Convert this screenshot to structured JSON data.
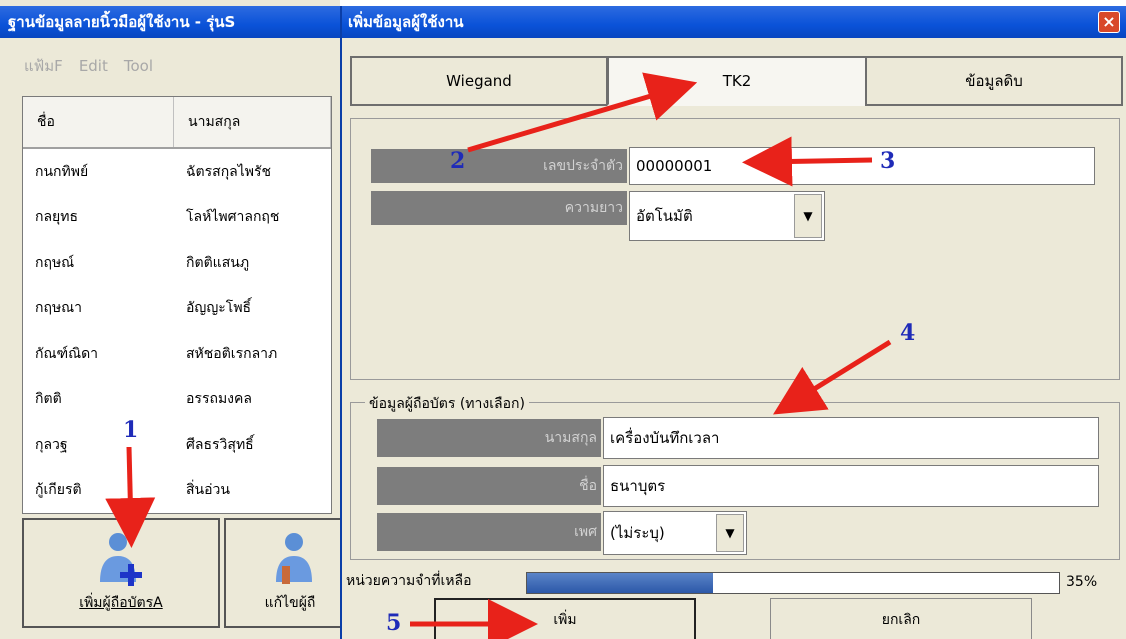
{
  "main_window": {
    "title": "ฐานข้อมูลลายนิ้วมือผู้ใช้งาน - รุ่นS",
    "menu": [
      "แฟ้มF",
      "Edit",
      "Tool"
    ],
    "list": {
      "headers": [
        "ชื่อ",
        "นามสกุล"
      ],
      "rows": [
        [
          "กนกทิพย์",
          "ฉัตรสกุลไพรัช"
        ],
        [
          "กลยุทธ",
          "โลห์ไพศาลกฤช"
        ],
        [
          "กฤษณ์",
          "กิตติแสนภู"
        ],
        [
          "กฤษณา",
          "อัญญะโพธิ์"
        ],
        [
          "กัณฑ์ณิดา",
          "สหัชอติเรกลาภ"
        ],
        [
          "กิตติ",
          "อรรถมงคล"
        ],
        [
          "กุลวฐ",
          "ศีลธรวิสุทธิ์"
        ],
        [
          "กู้เกียรติ",
          "สิ่นอ่วน"
        ]
      ]
    },
    "toolbar": {
      "add_label": "เพิ่มผู้ถือบัตรA",
      "edit_label": "แก้ไขผู้ถื"
    }
  },
  "dialog": {
    "title": "เพิ่มข้อมูลผู้ใช้งาน",
    "close_label": "×",
    "tabs": [
      "Wiegand",
      "TK2",
      "ข้อมูลดิบ"
    ],
    "id_label": "เลขประจำตัว",
    "id_value": "00000001",
    "length_label": "ความยาว",
    "length_value": "อัตโนมัติ",
    "optional_group_label": "ข้อมูลผู้ถือบัตร (ทางเลือก)",
    "surname_label": "นามสกุล",
    "surname_value": "เครื่องบันทึกเวลา",
    "name_label": "ชื่อ",
    "name_value": "ธนาบุตร",
    "sex_label": "เพศ",
    "sex_value": "(ไม่ระบุ)",
    "memory_label": "หน่วยความจำที่เหลือ",
    "memory_percent_text": "35%",
    "memory_fraction": 0.35,
    "add_label": "เพิ่ม",
    "cancel_label": "ยกเลิก"
  },
  "annotations": [
    "1",
    "2",
    "3",
    "4",
    "5"
  ],
  "colors": {
    "title_bar": "#0a52d8",
    "annotation_arrow": "#e8221a",
    "annotation_number": "#1f2bb8"
  }
}
